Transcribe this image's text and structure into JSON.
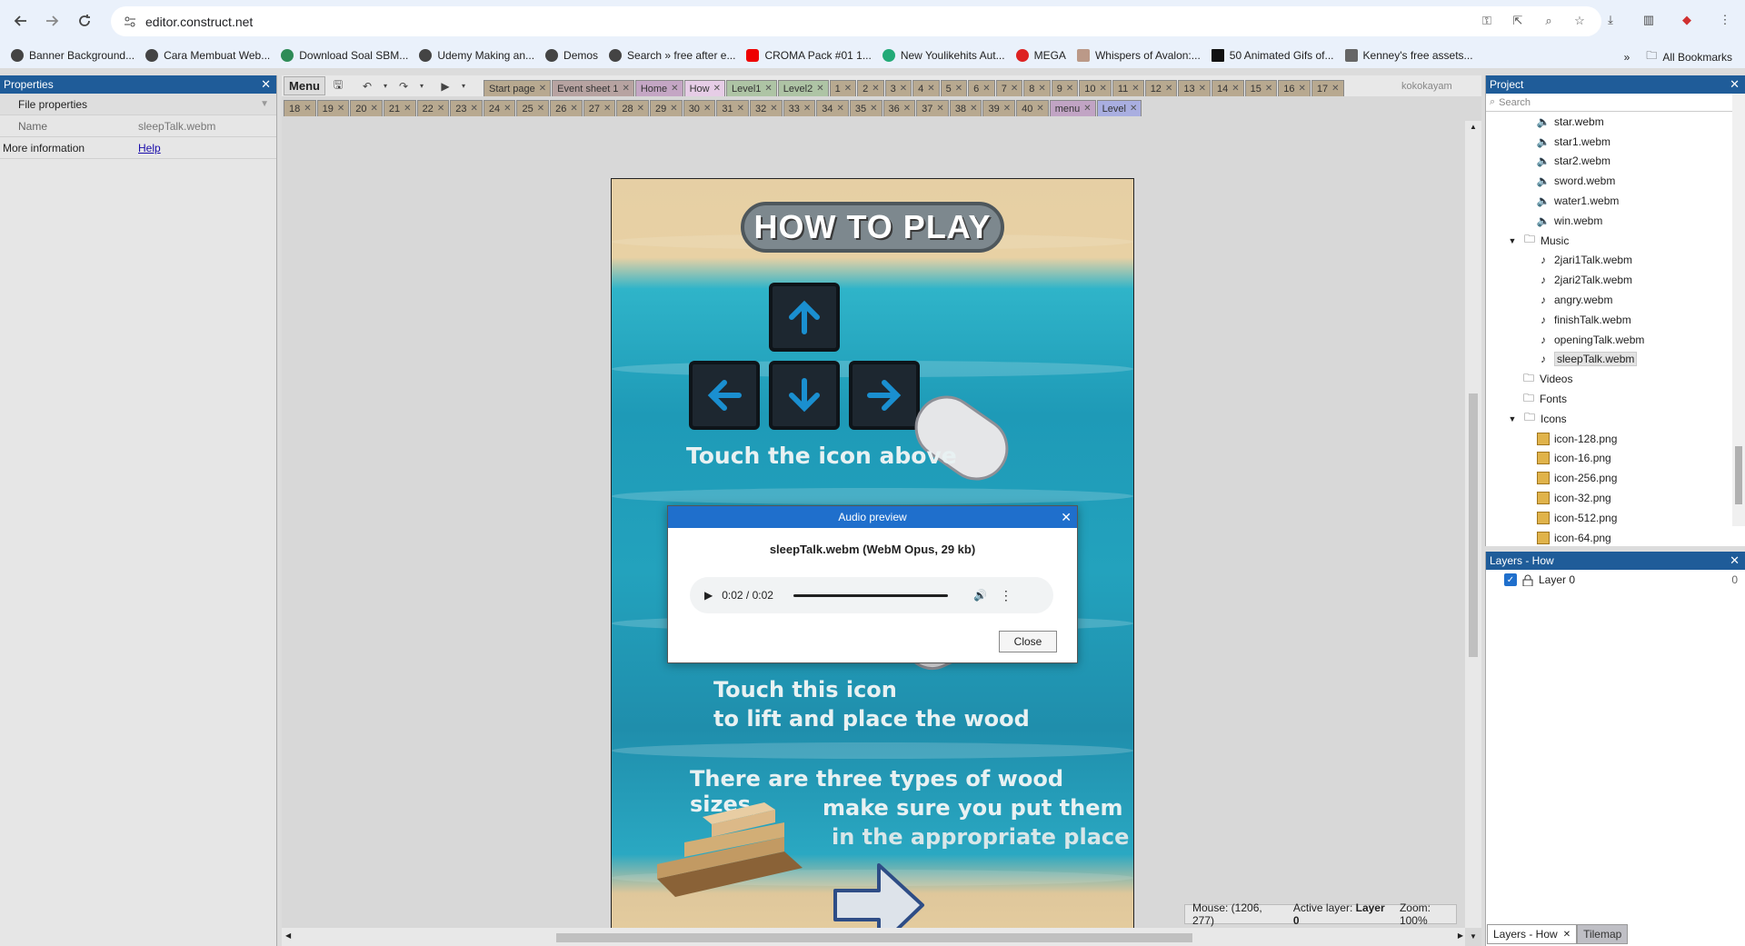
{
  "browser": {
    "url": "editor.construct.net",
    "bookmarks": [
      "Banner Background...",
      "Cara Membuat Web...",
      "Download Soal SBM...",
      "Udemy Making an...",
      "Demos",
      "Search » free after e...",
      "CROMA Pack #01 1...",
      "New Youlikehits Aut...",
      "MEGA",
      "Whispers of Avalon:...",
      "50 Animated Gifs of...",
      "Kenney's free assets..."
    ],
    "all_bookmarks": "All Bookmarks"
  },
  "properties": {
    "title": "Properties",
    "section": "File properties",
    "name_label": "Name",
    "name_value": "sleepTalk.webm",
    "more_label": "More information",
    "help_link": "Help"
  },
  "editor": {
    "menu_label": "Menu",
    "user": "kokokayam",
    "tabs_row1": [
      "Start page",
      "Event sheet 1",
      "Home",
      "How",
      "Level1",
      "Level2",
      "1",
      "2",
      "3",
      "4",
      "5",
      "6",
      "7",
      "8",
      "9",
      "10",
      "11",
      "12",
      "13",
      "14",
      "15",
      "16",
      "17"
    ],
    "tabs_row2": [
      "18",
      "19",
      "20",
      "21",
      "22",
      "23",
      "24",
      "25",
      "26",
      "27",
      "28",
      "29",
      "30",
      "31",
      "32",
      "33",
      "34",
      "35",
      "36",
      "37",
      "38",
      "39",
      "40",
      "menu",
      "Level"
    ],
    "status": {
      "mouse": "Mouse: (1206, 277)",
      "layer_label": "Active layer:",
      "layer_value": "Layer 0",
      "zoom": "Zoom: 100%"
    }
  },
  "layout_game": {
    "title": "HOW TO PLAY",
    "text1": "Touch the icon above",
    "text2a": "Touch this icon",
    "text2b": "to lift and place the wood",
    "text3a": "There are three types of wood sizes,",
    "text3b": "make sure you put them",
    "text3c": "in the appropriate place"
  },
  "dialog": {
    "title": "Audio preview",
    "file": "sleepTalk.webm (WebM Opus, 29 kb)",
    "time": "0:02 / 0:02",
    "close_label": "Close"
  },
  "project": {
    "title": "Project",
    "search_placeholder": "Search",
    "sounds": [
      "star.webm",
      "star1.webm",
      "star2.webm",
      "sword.webm",
      "water1.webm",
      "win.webm"
    ],
    "music_folder": "Music",
    "music": [
      "2jari1Talk.webm",
      "2jari2Talk.webm",
      "angry.webm",
      "finishTalk.webm",
      "openingTalk.webm",
      "sleepTalk.webm"
    ],
    "videos_folder": "Videos",
    "fonts_folder": "Fonts",
    "icons_folder": "Icons",
    "icons": [
      "icon-128.png",
      "icon-16.png",
      "icon-256.png",
      "icon-32.png",
      "icon-512.png",
      "icon-64.png"
    ]
  },
  "layers": {
    "title": "Layers - How",
    "layer_name": "Layer 0",
    "layer_index": "0",
    "bottom_tab1": "Layers - How",
    "bottom_tab2": "Tilemap"
  },
  "colors": {
    "panel_header": "#1f5c99",
    "dialog_header": "#1f6fcc",
    "accent": "#1a73e8"
  }
}
